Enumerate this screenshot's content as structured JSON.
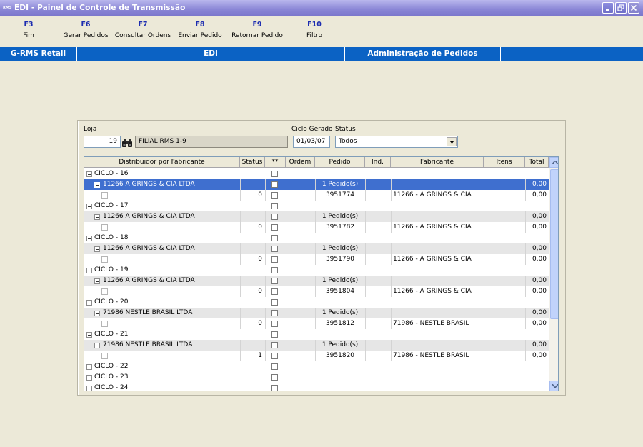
{
  "window": {
    "app_badge": "RMS",
    "title": "EDI - Painel de Controle de Transmissão"
  },
  "fkeys": [
    {
      "key": "F3",
      "label": "Fim"
    },
    {
      "key": "F6",
      "label": "Gerar Pedidos"
    },
    {
      "key": "F7",
      "label": "Consultar Ordens"
    },
    {
      "key": "F8",
      "label": "Enviar Pedido"
    },
    {
      "key": "F9",
      "label": "Retornar Pedido"
    },
    {
      "key": "F10",
      "label": "Filtro"
    }
  ],
  "modbar": {
    "system": "G-RMS Retail",
    "module": "EDI",
    "screen": "Administração de Pedidos"
  },
  "form": {
    "loja_label": "Loja",
    "loja_value": "19",
    "loja_name": "FILIAL RMS 1-9",
    "ciclo_label": "Ciclo Gerado",
    "ciclo_value": "01/03/07",
    "status_label": "Status",
    "status_value": "Todos"
  },
  "grid": {
    "columns": [
      "Distribuidor por Fabricante",
      "Status",
      "**",
      "Ordem",
      "Pedido",
      "Ind.",
      "Fabricante",
      "Itens",
      "Total"
    ],
    "rows": [
      {
        "kind": "ciclo",
        "label": "CICLO - 16"
      },
      {
        "kind": "dist",
        "label": "11266 A GRINGS & CIA LTDA",
        "pedido": "1 Pedido(s)",
        "total": "0,00",
        "selected": true
      },
      {
        "kind": "item",
        "status": "0",
        "pedido": "3951774",
        "fabricante": "11266 - A GRINGS & CIA",
        "total": "0,00"
      },
      {
        "kind": "ciclo",
        "label": "CICLO - 17"
      },
      {
        "kind": "dist",
        "label": "11266 A GRINGS & CIA LTDA",
        "pedido": "1 Pedido(s)",
        "total": "0,00"
      },
      {
        "kind": "item",
        "status": "0",
        "pedido": "3951782",
        "fabricante": "11266 - A GRINGS & CIA",
        "total": "0,00"
      },
      {
        "kind": "ciclo",
        "label": "CICLO - 18"
      },
      {
        "kind": "dist",
        "label": "11266 A GRINGS & CIA LTDA",
        "pedido": "1 Pedido(s)",
        "total": "0,00"
      },
      {
        "kind": "item",
        "status": "0",
        "pedido": "3951790",
        "fabricante": "11266 - A GRINGS & CIA",
        "total": "0,00"
      },
      {
        "kind": "ciclo",
        "label": "CICLO - 19"
      },
      {
        "kind": "dist",
        "label": "11266 A GRINGS & CIA LTDA",
        "pedido": "1 Pedido(s)",
        "total": "0,00"
      },
      {
        "kind": "item",
        "status": "0",
        "pedido": "3951804",
        "fabricante": "11266 - A GRINGS & CIA",
        "total": "0,00"
      },
      {
        "kind": "ciclo",
        "label": "CICLO - 20"
      },
      {
        "kind": "dist",
        "label": "71986 NESTLE BRASIL LTDA",
        "pedido": "1 Pedido(s)",
        "total": "0,00"
      },
      {
        "kind": "item",
        "status": "0",
        "pedido": "3951812",
        "fabricante": "71986 - NESTLE BRASIL",
        "total": "0,00"
      },
      {
        "kind": "ciclo",
        "label": "CICLO - 21"
      },
      {
        "kind": "dist",
        "label": "71986 NESTLE BRASIL LTDA",
        "pedido": "1 Pedido(s)",
        "total": "0,00"
      },
      {
        "kind": "item",
        "status": "1",
        "pedido": "3951820",
        "fabricante": "71986 - NESTLE BRASIL",
        "total": "0,00"
      },
      {
        "kind": "ciclo-empty",
        "label": "CICLO - 22"
      },
      {
        "kind": "ciclo-empty",
        "label": "CICLO - 23"
      },
      {
        "kind": "ciclo-empty",
        "label": "CICLO - 24"
      }
    ]
  },
  "colors": {
    "accent": "#0b62c4",
    "selection": "#3f6fcf",
    "fkey": "#1c2cb0"
  }
}
